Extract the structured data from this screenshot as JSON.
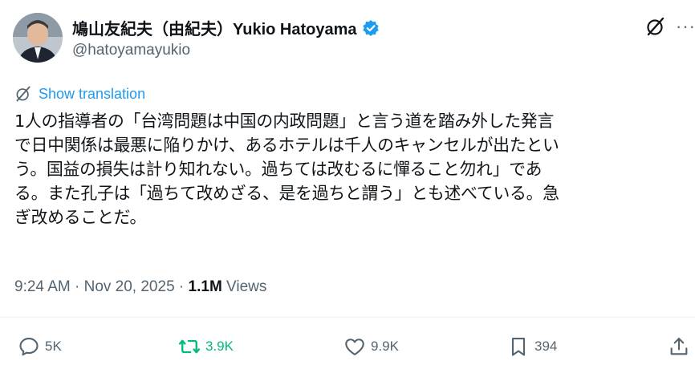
{
  "author": {
    "display_name": "鳩山友紀夫（由紀夫）Yukio Hatoyama",
    "handle": "@hatoyamayukio",
    "verified": true
  },
  "translate": {
    "label": "Show translation"
  },
  "tweet": {
    "text": "1人の指導者の「台湾問題は中国の内政問題」と言う道を踏み外した発言\nで日中関係は最悪に陥りかけ、あるホテルは千人のキャンセルが出たとい\nう。国益の損失は計り知れない。過ちては改むるに憚ること勿れ」であ\nる。また孔子は「過ちて改めざる、是を過ちと謂う」とも述べている。急\nぎ改めることだ。"
  },
  "meta": {
    "time": "9:24 AM",
    "separator1": " · ",
    "date": "Nov 20, 2025",
    "separator2": " · ",
    "views_count": "1.1M",
    "views_label": " Views"
  },
  "actions": {
    "replies": "5K",
    "reposts": "3.9K",
    "likes": "9.9K",
    "bookmarks": "394"
  },
  "colors": {
    "accent": "#1d9bf0",
    "repost": "#00ba7c",
    "muted": "#536471",
    "text": "#0f1419"
  }
}
